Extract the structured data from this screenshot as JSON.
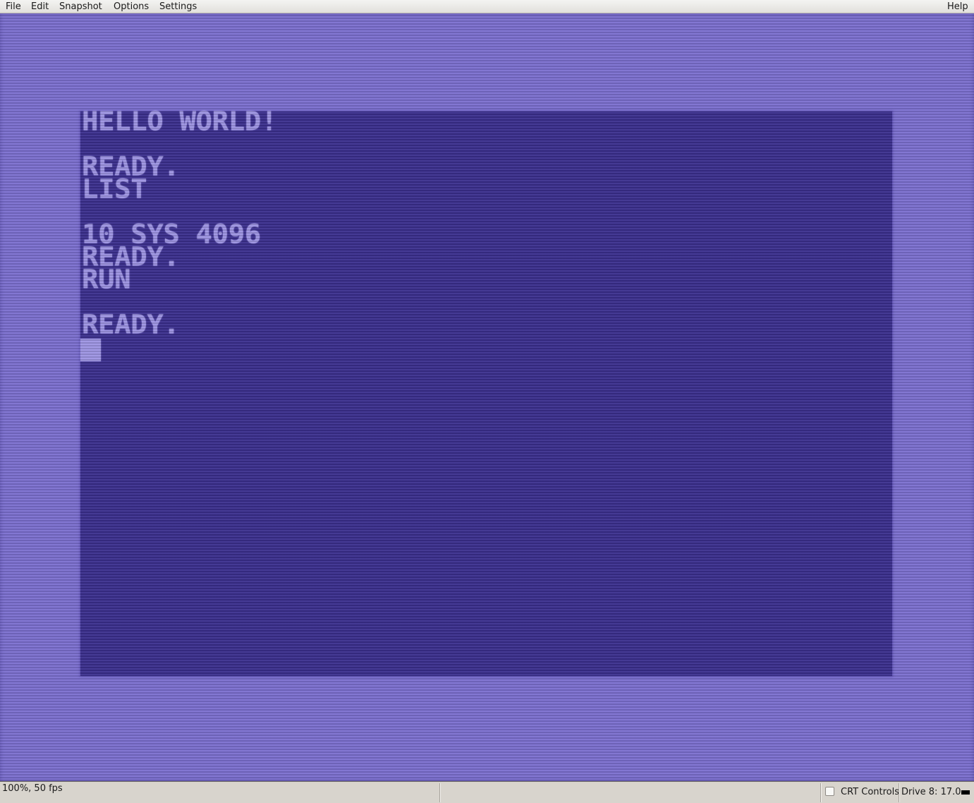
{
  "menubar": {
    "file": "File",
    "edit": "Edit",
    "snapshot": "Snapshot",
    "options": "Options",
    "settings": "Settings",
    "help": "Help"
  },
  "emulator": {
    "lines": [
      "HELLO WORLD!",
      "READY.",
      "LIST",
      "10 SYS 4096",
      "READY.",
      "RUN",
      "READY."
    ]
  },
  "statusbar": {
    "speed": "100%, 50 fps",
    "crt_controls_label": "CRT Controls",
    "drive_status": "Drive 8: 17.0"
  },
  "colors": {
    "border": "#7c70d0",
    "background": "#3b2f8e",
    "text": "#9e95e4"
  }
}
